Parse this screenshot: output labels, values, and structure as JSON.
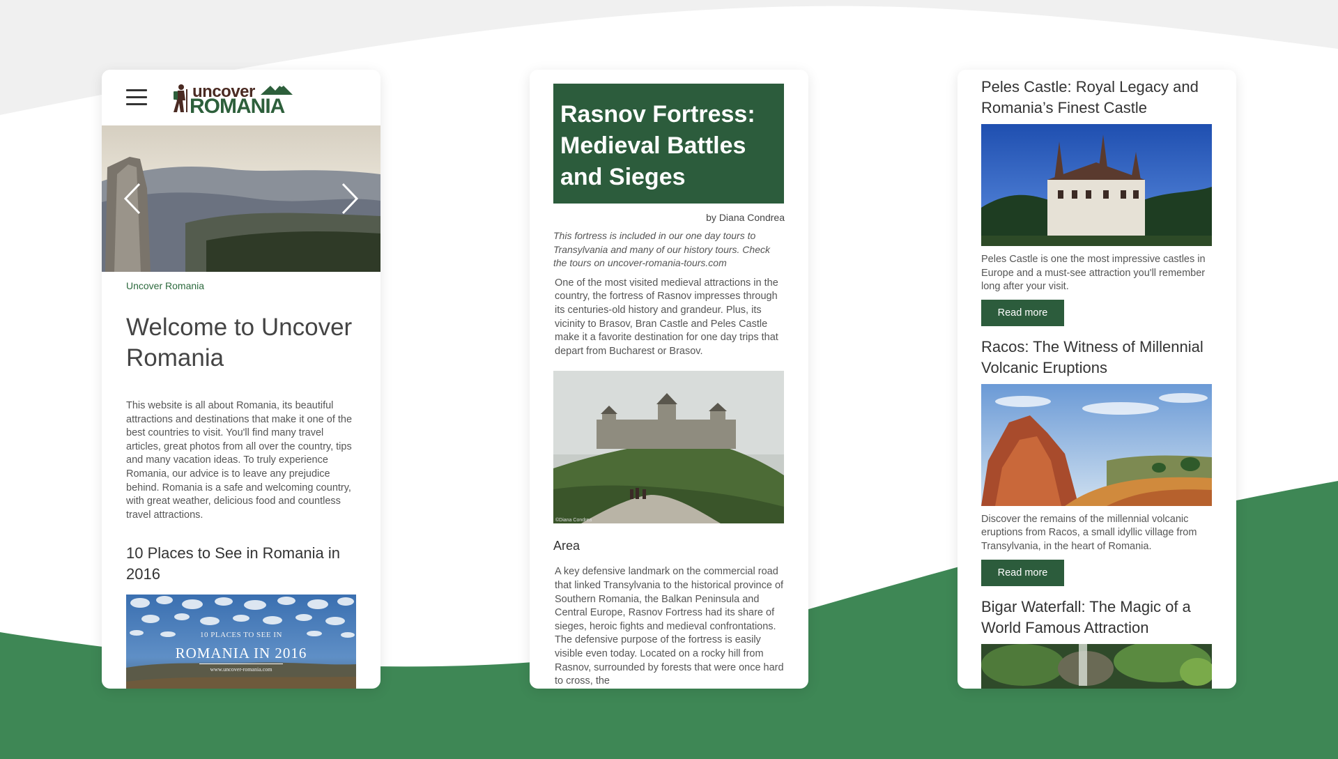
{
  "colors": {
    "brand_green": "#2c5c3c",
    "background_green": "#3e8755",
    "page_background": "#f0f0f0",
    "text": "#444444"
  },
  "phone_home": {
    "menu_icon": "hamburger-icon",
    "logo": {
      "top": "uncover",
      "bottom": "ROMANIA"
    },
    "slider": {
      "prev_icon": "chevron-left-icon",
      "next_icon": "chevron-right-icon"
    },
    "breadcrumb": "Uncover Romania",
    "title": "Welcome to Uncover Romania",
    "intro": "This website is all about Romania, its beautiful attractions and destinations that make it one of the best countries to visit. You'll find many travel articles, great photos from all over the country, tips and many vacation ideas. To truly experience Romania, our advice is to leave any prejudice behind. Romania is a safe and welcoming country, with great weather, delicious food and countless travel attractions.",
    "subtitle": "10 Places to See in Romania in 2016",
    "banner": {
      "line1": "10 PLACES TO SEE IN",
      "line2": "ROMANIA IN 2016",
      "line3": "www.uncover-romania.com"
    }
  },
  "phone_article": {
    "title": "Rasnov Fortress: Medieval Battles and Sieges",
    "byline": "by Diana Condrea",
    "lead": "This fortress is included in our one day tours to Transylvania and many of our history tours. Check the tours on uncover-romania-tours.com",
    "paragraph1": "One of the most visited medieval attractions in the country, the fortress of Rasnov impresses through its centuries-old history and grandeur. Plus, its vicinity to Brasov, Bran Castle and Peles Castle make it a favorite destination for one day trips that depart from Bucharest or Brasov.",
    "photo_credit": "©Diana Condrea",
    "section_heading": "Area",
    "paragraph2": "A key defensive landmark on the commercial road that linked Transylvania to the historical province of Southern Romania, the Balkan Peninsula and Central Europe, Rasnov Fortress had its share of sieges, heroic fights and medieval confrontations. The defensive purpose of the fortress is easily visible even today. Located on a rocky hill from Rasnov, surrounded by forests that were once hard to cross, the"
  },
  "phone_list": {
    "cards": [
      {
        "title": "Peles Castle: Royal Legacy and Romania’s Finest Castle",
        "description": "Peles Castle is one the most impressive castles in Europe and a must-see attraction you'll remember long after your visit.",
        "button": "Read more"
      },
      {
        "title": "Racos: The Witness of Millennial Volcanic Eruptions",
        "description": "Discover the remains of the millennial volcanic eruptions from Racos, a small idyllic village from Transylvania, in the heart of Romania.",
        "button": "Read more"
      },
      {
        "title": "Bigar Waterfall: The Magic of a World Famous Attraction"
      }
    ]
  }
}
